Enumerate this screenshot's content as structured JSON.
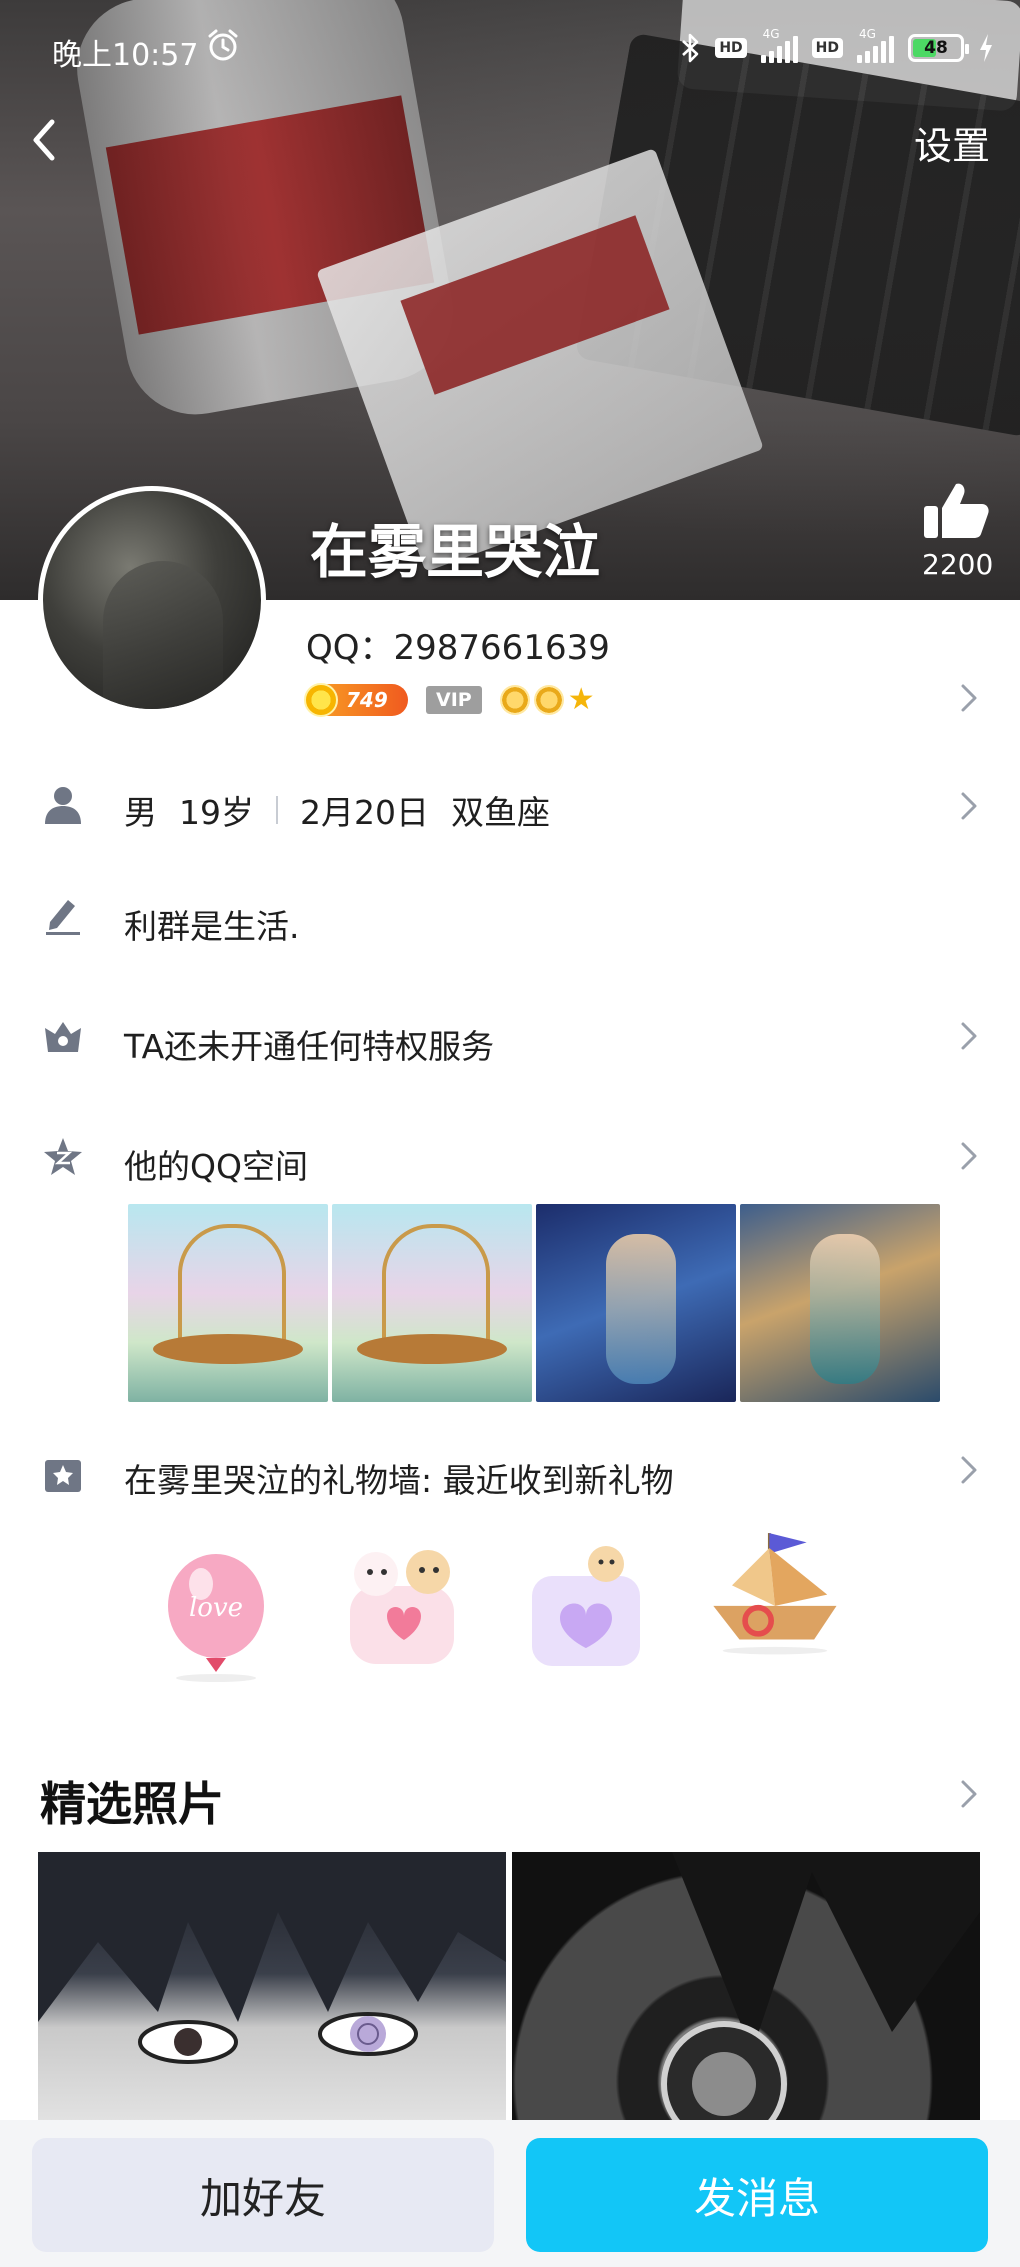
{
  "status_bar": {
    "time": "晚上10:57",
    "hd_label": "HD",
    "network_label": "4G",
    "battery_percent": "48"
  },
  "header": {
    "settings_label": "设置",
    "nickname": "在雾里哭泣",
    "like_count": "2200"
  },
  "profile": {
    "qq_number": "QQ：2987661639",
    "coin_level": "749",
    "vip_label": "VIP"
  },
  "rows": {
    "gender": "男",
    "age": "19岁",
    "birthday": "2月20日",
    "zodiac": "双鱼座",
    "signature": "利群是生活.",
    "privilege": "TA还未开通任何特权服务",
    "qzone": "他的QQ空间",
    "gift_wall": "在雾里哭泣的礼物墙: 最近收到新礼物"
  },
  "gifts": {
    "balloon_text": "love"
  },
  "featured": {
    "title": "精选照片"
  },
  "actions": {
    "add_friend": "加好友",
    "send_message": "发消息"
  },
  "colors": {
    "primary": "#12c6f7",
    "secondary_button": "#e7e9f3",
    "icon_gray": "#6f7685"
  }
}
